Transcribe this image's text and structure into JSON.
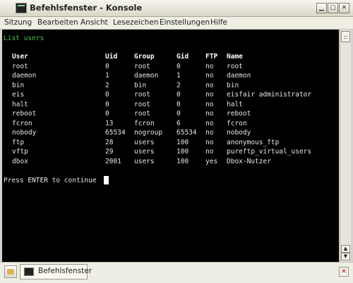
{
  "window": {
    "title": "Befehlsfenster - Konsole",
    "icon": "terminal-icon",
    "buttons": {
      "minimize": "▁",
      "maximize": "▢",
      "close": "✕"
    }
  },
  "menu": {
    "items": [
      "Sitzung",
      "Bearbeiten",
      "Ansicht",
      "Lesezeichen",
      "Einstellungen",
      "Hilfe"
    ]
  },
  "terminal": {
    "title": "List users",
    "columns": [
      "User",
      "Uid",
      "Group",
      "Gid",
      "FTP",
      "Name"
    ],
    "rows": [
      [
        "root",
        "0",
        "root",
        "0",
        "no",
        "root"
      ],
      [
        "daemon",
        "1",
        "daemon",
        "1",
        "no",
        "daemon"
      ],
      [
        "bin",
        "2",
        "bin",
        "2",
        "no",
        "bin"
      ],
      [
        "eis",
        "0",
        "root",
        "0",
        "no",
        "eisfair administrator"
      ],
      [
        "halt",
        "0",
        "root",
        "0",
        "no",
        "halt"
      ],
      [
        "reboot",
        "0",
        "root",
        "0",
        "no",
        "reboot"
      ],
      [
        "fcron",
        "13",
        "fcron",
        "6",
        "no",
        "fcron"
      ],
      [
        "nobody",
        "65534",
        "nogroup",
        "65534",
        "no",
        "nobody"
      ],
      [
        "ftp",
        "28",
        "users",
        "100",
        "no",
        "anonymous_ftp"
      ],
      [
        "vftp",
        "29",
        "users",
        "100",
        "no",
        "pureftp_virtual_users"
      ],
      [
        "dbox",
        "2001",
        "users",
        "100",
        "yes",
        "Dbox-Nutzer"
      ]
    ],
    "prompt": "Press ENTER to continue",
    "colors": {
      "background": "#000000",
      "text": "#e6e6e6",
      "title": "#3cc83c"
    }
  },
  "scrollbar": {
    "up": "▲",
    "down": "▼"
  },
  "tabbar": {
    "new_session_icon": "new-session-icon",
    "tab_label": "Befehlsfenster",
    "close_label": "✕"
  }
}
